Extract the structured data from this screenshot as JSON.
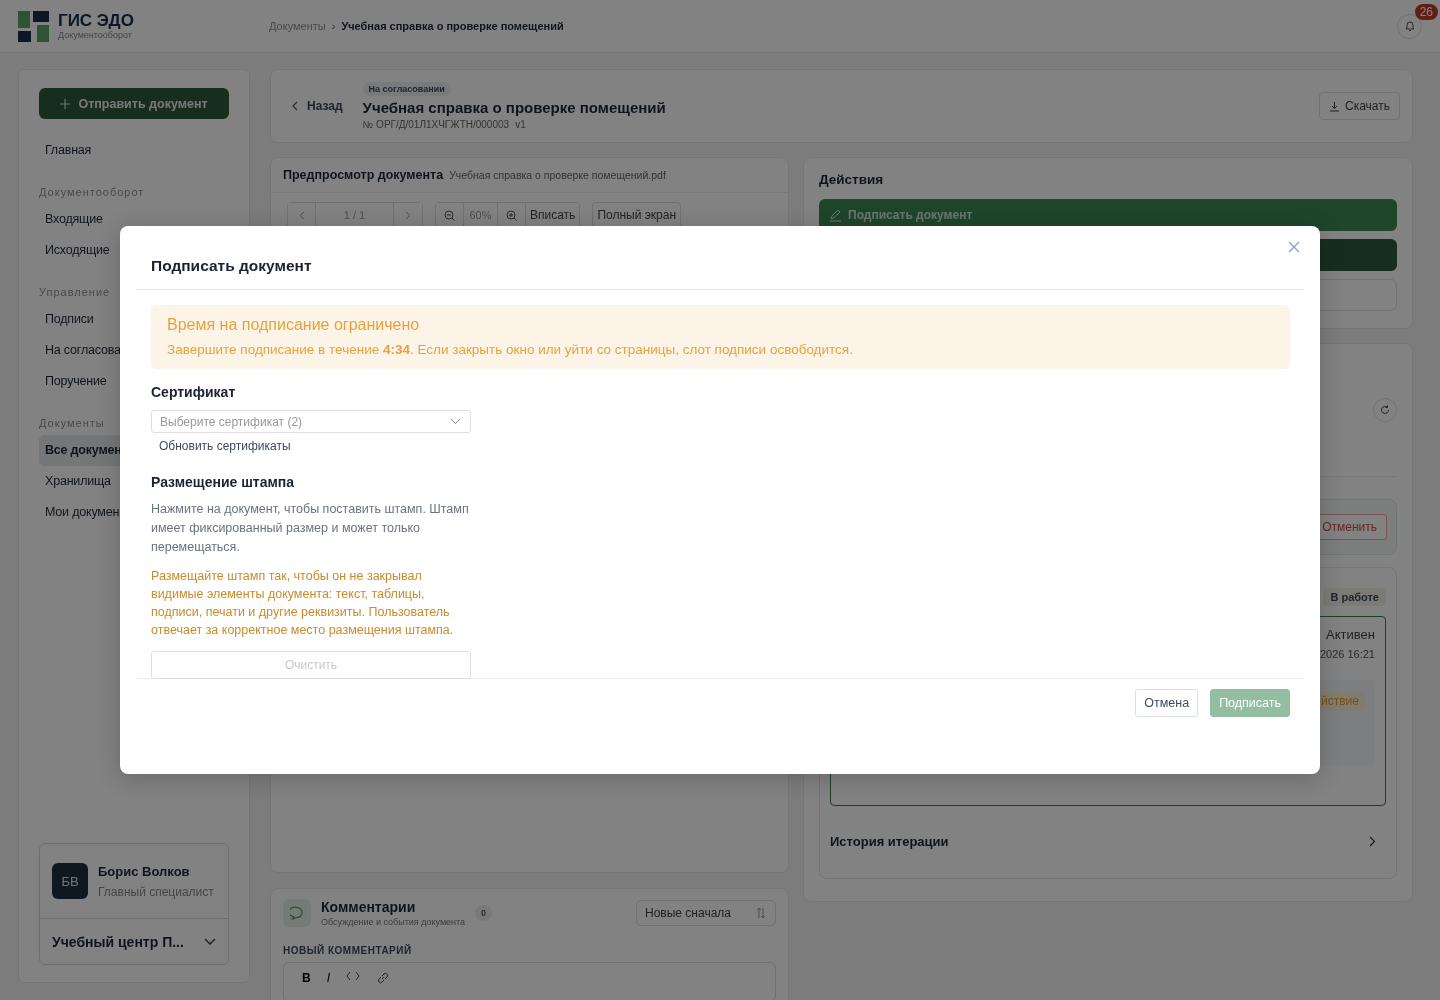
{
  "header": {
    "logo_title": "ГИС ЭДО",
    "logo_subtitle": "Документооборот",
    "breadcrumbs": [
      {
        "label": "Документы",
        "current": false
      },
      {
        "label": "Учебная справка о проверке помещений",
        "current": true
      }
    ],
    "breadcrumb_separator": "›",
    "notifications_count": "26"
  },
  "sidebar": {
    "send_button": "Отправить документ",
    "nav": [
      {
        "kind": "item",
        "label": "Главная",
        "selected": false
      },
      {
        "kind": "heading",
        "label": "Документооборот"
      },
      {
        "kind": "item",
        "label": "Входящие",
        "selected": false
      },
      {
        "kind": "item",
        "label": "Исходящие",
        "selected": false
      },
      {
        "kind": "heading",
        "label": "Управление"
      },
      {
        "kind": "item",
        "label": "Подписи",
        "selected": false
      },
      {
        "kind": "item",
        "label": "На согласова",
        "selected": false
      },
      {
        "kind": "item",
        "label": "Поручение",
        "selected": false
      },
      {
        "kind": "heading",
        "label": "Документы"
      },
      {
        "kind": "item",
        "label": "Все докумен",
        "selected": true
      },
      {
        "kind": "item",
        "label": "Хранилища",
        "selected": false
      },
      {
        "kind": "item",
        "label": "Мои докумен",
        "selected": false
      }
    ],
    "user": {
      "initials": "БВ",
      "name": "Борис Волков",
      "role": "Главный специалист",
      "org": "Учебный центр П..."
    }
  },
  "document": {
    "back": "Назад",
    "status": "На согласовании",
    "title": "Учебная справка о проверке помещений",
    "number": "№ ОРГ/Д/01Л1ХЧГЖТН/000003",
    "version": "v1",
    "download": "Скачать"
  },
  "preview": {
    "title": "Предпросмотр документа",
    "filename": "Учебная справка о проверке помещений.pdf",
    "page": "1 / 1",
    "zoom": "60%",
    "fit": "Вписать",
    "fullscreen": "Полный экран"
  },
  "comments": {
    "title": "Комментарии",
    "subtitle": "Обсуждение и события документа",
    "count": "0",
    "sort": "Новые сначала",
    "new_label": "НОВЫЙ КОММЕНТАРИЙ",
    "format_buttons": [
      "B",
      "I"
    ]
  },
  "actions": {
    "title": "Действия",
    "sign_button": "Подписать документ"
  },
  "workflow": {
    "cancel": "Отменить",
    "status": "В работе",
    "state": "Активен",
    "date": "2026 16:21",
    "badge": "йствие",
    "history": "История итерации"
  },
  "modal": {
    "title": "Подписать документ",
    "alert": {
      "title": "Время на подписание ограничено",
      "text": "Завершите подписание в течение **4:34**. Если закрыть окно или уйти со страницы, слот подписи освободится."
    },
    "certificate": {
      "label": "Сертификат",
      "placeholder": "Выберите сертификат (2)",
      "refresh": "Обновить сертификаты"
    },
    "stamp": {
      "label": "Размещение штампа",
      "hint": "Нажмите на документ, чтобы поставить штамп. Штамп имеет фиксированный размер и может только перемещаться.",
      "warning": "Размещайте штамп так, чтобы он не закрывал видимые элементы документа: текст, таблицы, подписи, печати и другие реквизиты. Пользователь отвечает за корректное место размещения штампа.",
      "clear": {
        "label": "Очистить",
        "disabled": true
      }
    },
    "cancel": {
      "label": "Отмена",
      "disabled": false
    },
    "submit": {
      "label": "Подписать",
      "disabled": true
    }
  }
}
